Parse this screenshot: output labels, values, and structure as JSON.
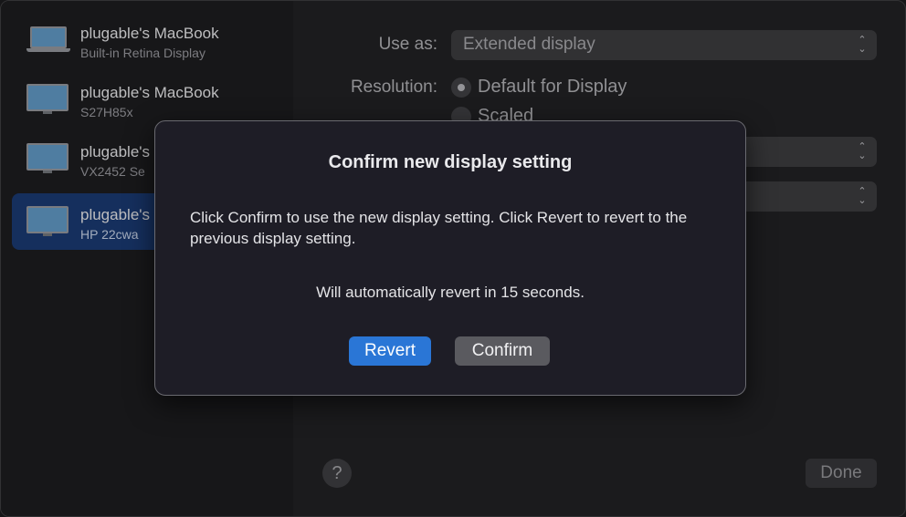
{
  "sidebar": {
    "displays": [
      {
        "name": "plugable's MacBook",
        "subtitle": "Built-in Retina Display",
        "icon": "laptop-icon",
        "selected": false
      },
      {
        "name": "plugable's MacBook",
        "subtitle": "S27H85x",
        "icon": "monitor-icon",
        "selected": false
      },
      {
        "name": "plugable's",
        "subtitle": "VX2452 Se",
        "icon": "monitor-icon",
        "selected": false
      },
      {
        "name": "plugable's",
        "subtitle": "HP 22cwa",
        "icon": "monitor-icon",
        "selected": true
      }
    ]
  },
  "settings": {
    "use_as_label": "Use as:",
    "use_as_value": "Extended display",
    "resolution_label": "Resolution:",
    "resolution_options": [
      "Default for Display",
      "Scaled"
    ],
    "resolution_selected": "Default for Display"
  },
  "footer": {
    "help_label": "?",
    "done_label": "Done"
  },
  "dialog": {
    "title": "Confirm new display setting",
    "body": "Click Confirm to use the new display setting. Click Revert to revert to the previous display setting.",
    "countdown": "Will automatically revert in 15 seconds.",
    "revert_label": "Revert",
    "confirm_label": "Confirm"
  },
  "colors": {
    "accent": "#2a76d6",
    "selected_row": "#18366a",
    "dialog_bg": "#1e1d26"
  }
}
